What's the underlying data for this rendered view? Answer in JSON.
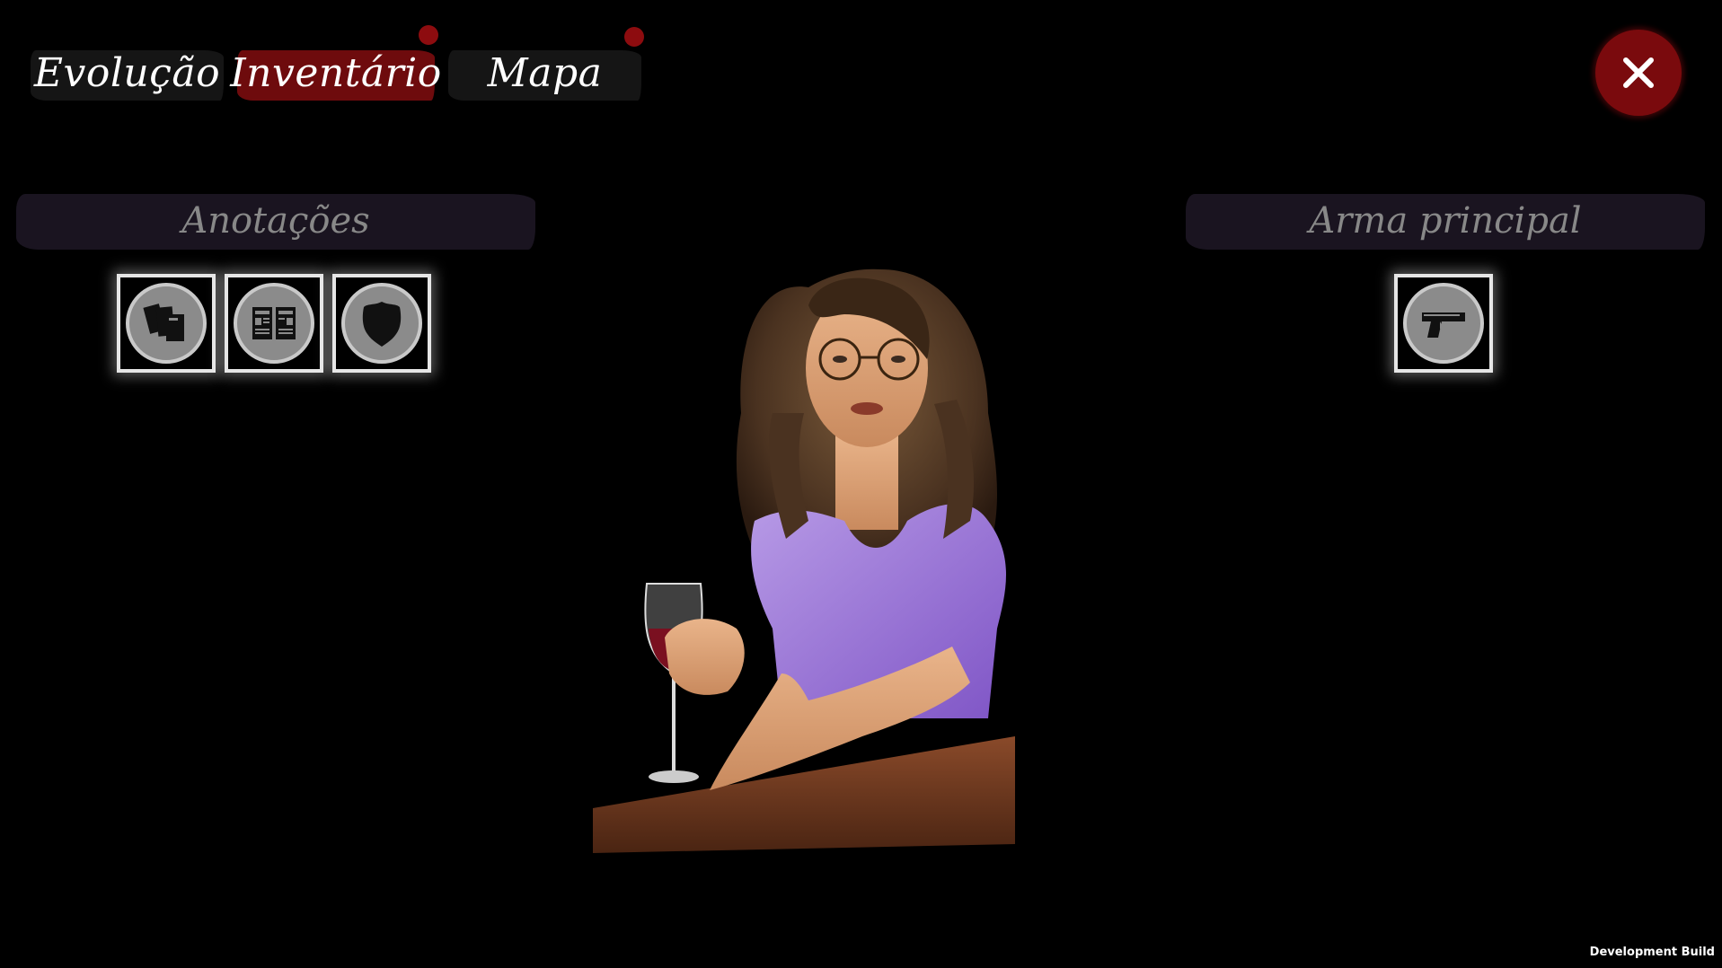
{
  "tabs": [
    {
      "label": "Evolução",
      "active": false,
      "notification": false
    },
    {
      "label": "Inventário",
      "active": true,
      "notification": true
    },
    {
      "label": "Mapa",
      "active": false,
      "notification": true
    }
  ],
  "close_icon": "close-icon",
  "left_panel": {
    "title": "Anotações",
    "slots": [
      {
        "icon": "documents-icon"
      },
      {
        "icon": "newspaper-icon"
      },
      {
        "icon": "police-badge-icon"
      }
    ]
  },
  "right_panel": {
    "title": "Arma principal",
    "slots": [
      {
        "icon": "pistol-icon"
      }
    ]
  },
  "footer": {
    "dev_label": "Development Build"
  },
  "colors": {
    "accent_red": "#7a0a0d",
    "header_bg": "#1a1420",
    "slot_fill": "#8b8b8b"
  }
}
